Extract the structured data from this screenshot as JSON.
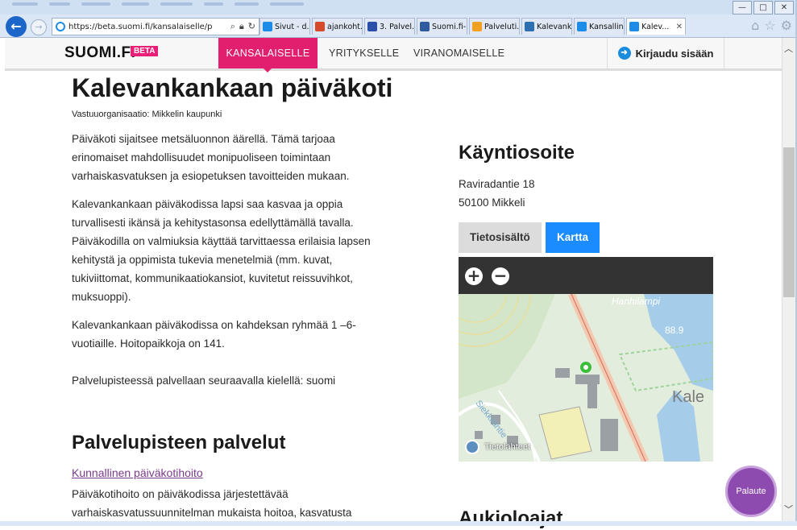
{
  "browser": {
    "address_url": "https://beta.suomi.fi/kansalaiselle/p",
    "tabs": [
      {
        "label": "Sivut - d...",
        "color": "#1d8ce8"
      },
      {
        "label": "ajankoht...",
        "color": "#d64a2b"
      },
      {
        "label": "3. Palvel...",
        "color": "#2a4fa8"
      },
      {
        "label": "Suomi.fi-...",
        "color": "#2f5c9e"
      },
      {
        "label": "Palveluti...",
        "color": "#f2a021"
      },
      {
        "label": "Kalevank...",
        "color": "#2c6fb0"
      },
      {
        "label": "Kansallin...",
        "color": "#1d8ce8"
      },
      {
        "label": "Kalev...",
        "color": "#1d8ce8"
      }
    ],
    "window_buttons": [
      "—",
      "□",
      "✕"
    ]
  },
  "header": {
    "logo": "SUOMI.FI",
    "beta_badge": "BETA",
    "nav": [
      "KANSALAISELLE",
      "YRITYKSELLE",
      "VIRANOMAISELLE"
    ],
    "login_label": "Kirjaudu sisään",
    "accent_color": "#e21f6f"
  },
  "page": {
    "title": "Kalevankankaan päiväkoti",
    "responsible_org": "Vastuuorganisaatio: Mikkelin kaupunki",
    "paragraphs": [
      "Päiväkoti sijaitsee metsäluonnon äärellä. Tämä tarjoaa erinomaiset mahdollisuudet monipuoliseen toimintaan varhaiskasvatuksen ja esiopetuksen tavoitteiden mukaan.",
      "Kalevankankaan päiväkodissa lapsi saa kasvaa ja oppia turvallisesti ikänsä ja kehitystasonsa edellyttämällä tavalla. Päiväkodilla on valmiuksia käyttää tarvittaessa erilaisia lapsen kehitystä ja oppimista tukevia menetelmiä (mm. kuvat, tukiviittomat, kommunikaatiokansiot, kuvitetut reissuvihkot, muksuoppi).",
      "Kalevankankaan päiväkodissa on kahdeksan ryhmää 1 –6-vuotiaille. Hoitopaikkoja on 141.",
      "Palvelupisteessä palvellaan seuraavalla kielellä: suomi"
    ],
    "services_heading": "Palvelupisteen palvelut",
    "service_link": "Kunnallinen päiväkotihoito",
    "service_desc": "Päiväkotihoito on päiväkodissa järjestettävää varhaiskasvatussuunnitelman mukaista hoitoa, kasvatusta"
  },
  "visit": {
    "heading": "Käyntiosoite",
    "street": "Raviradantie 18",
    "city": "50100 Mikkeli",
    "tab_info": "Tietosisältö",
    "tab_map": "Kartta",
    "map_labels": {
      "lake": "Hanhilampi",
      "elevation": "88.9",
      "area": "Kale",
      "road": "Siekkilantie",
      "sources": "Tietolähteet"
    },
    "zoom_in": "+",
    "zoom_out": "−"
  },
  "opening_heading": "Aukioloajat",
  "feedback_label": "Palaute"
}
